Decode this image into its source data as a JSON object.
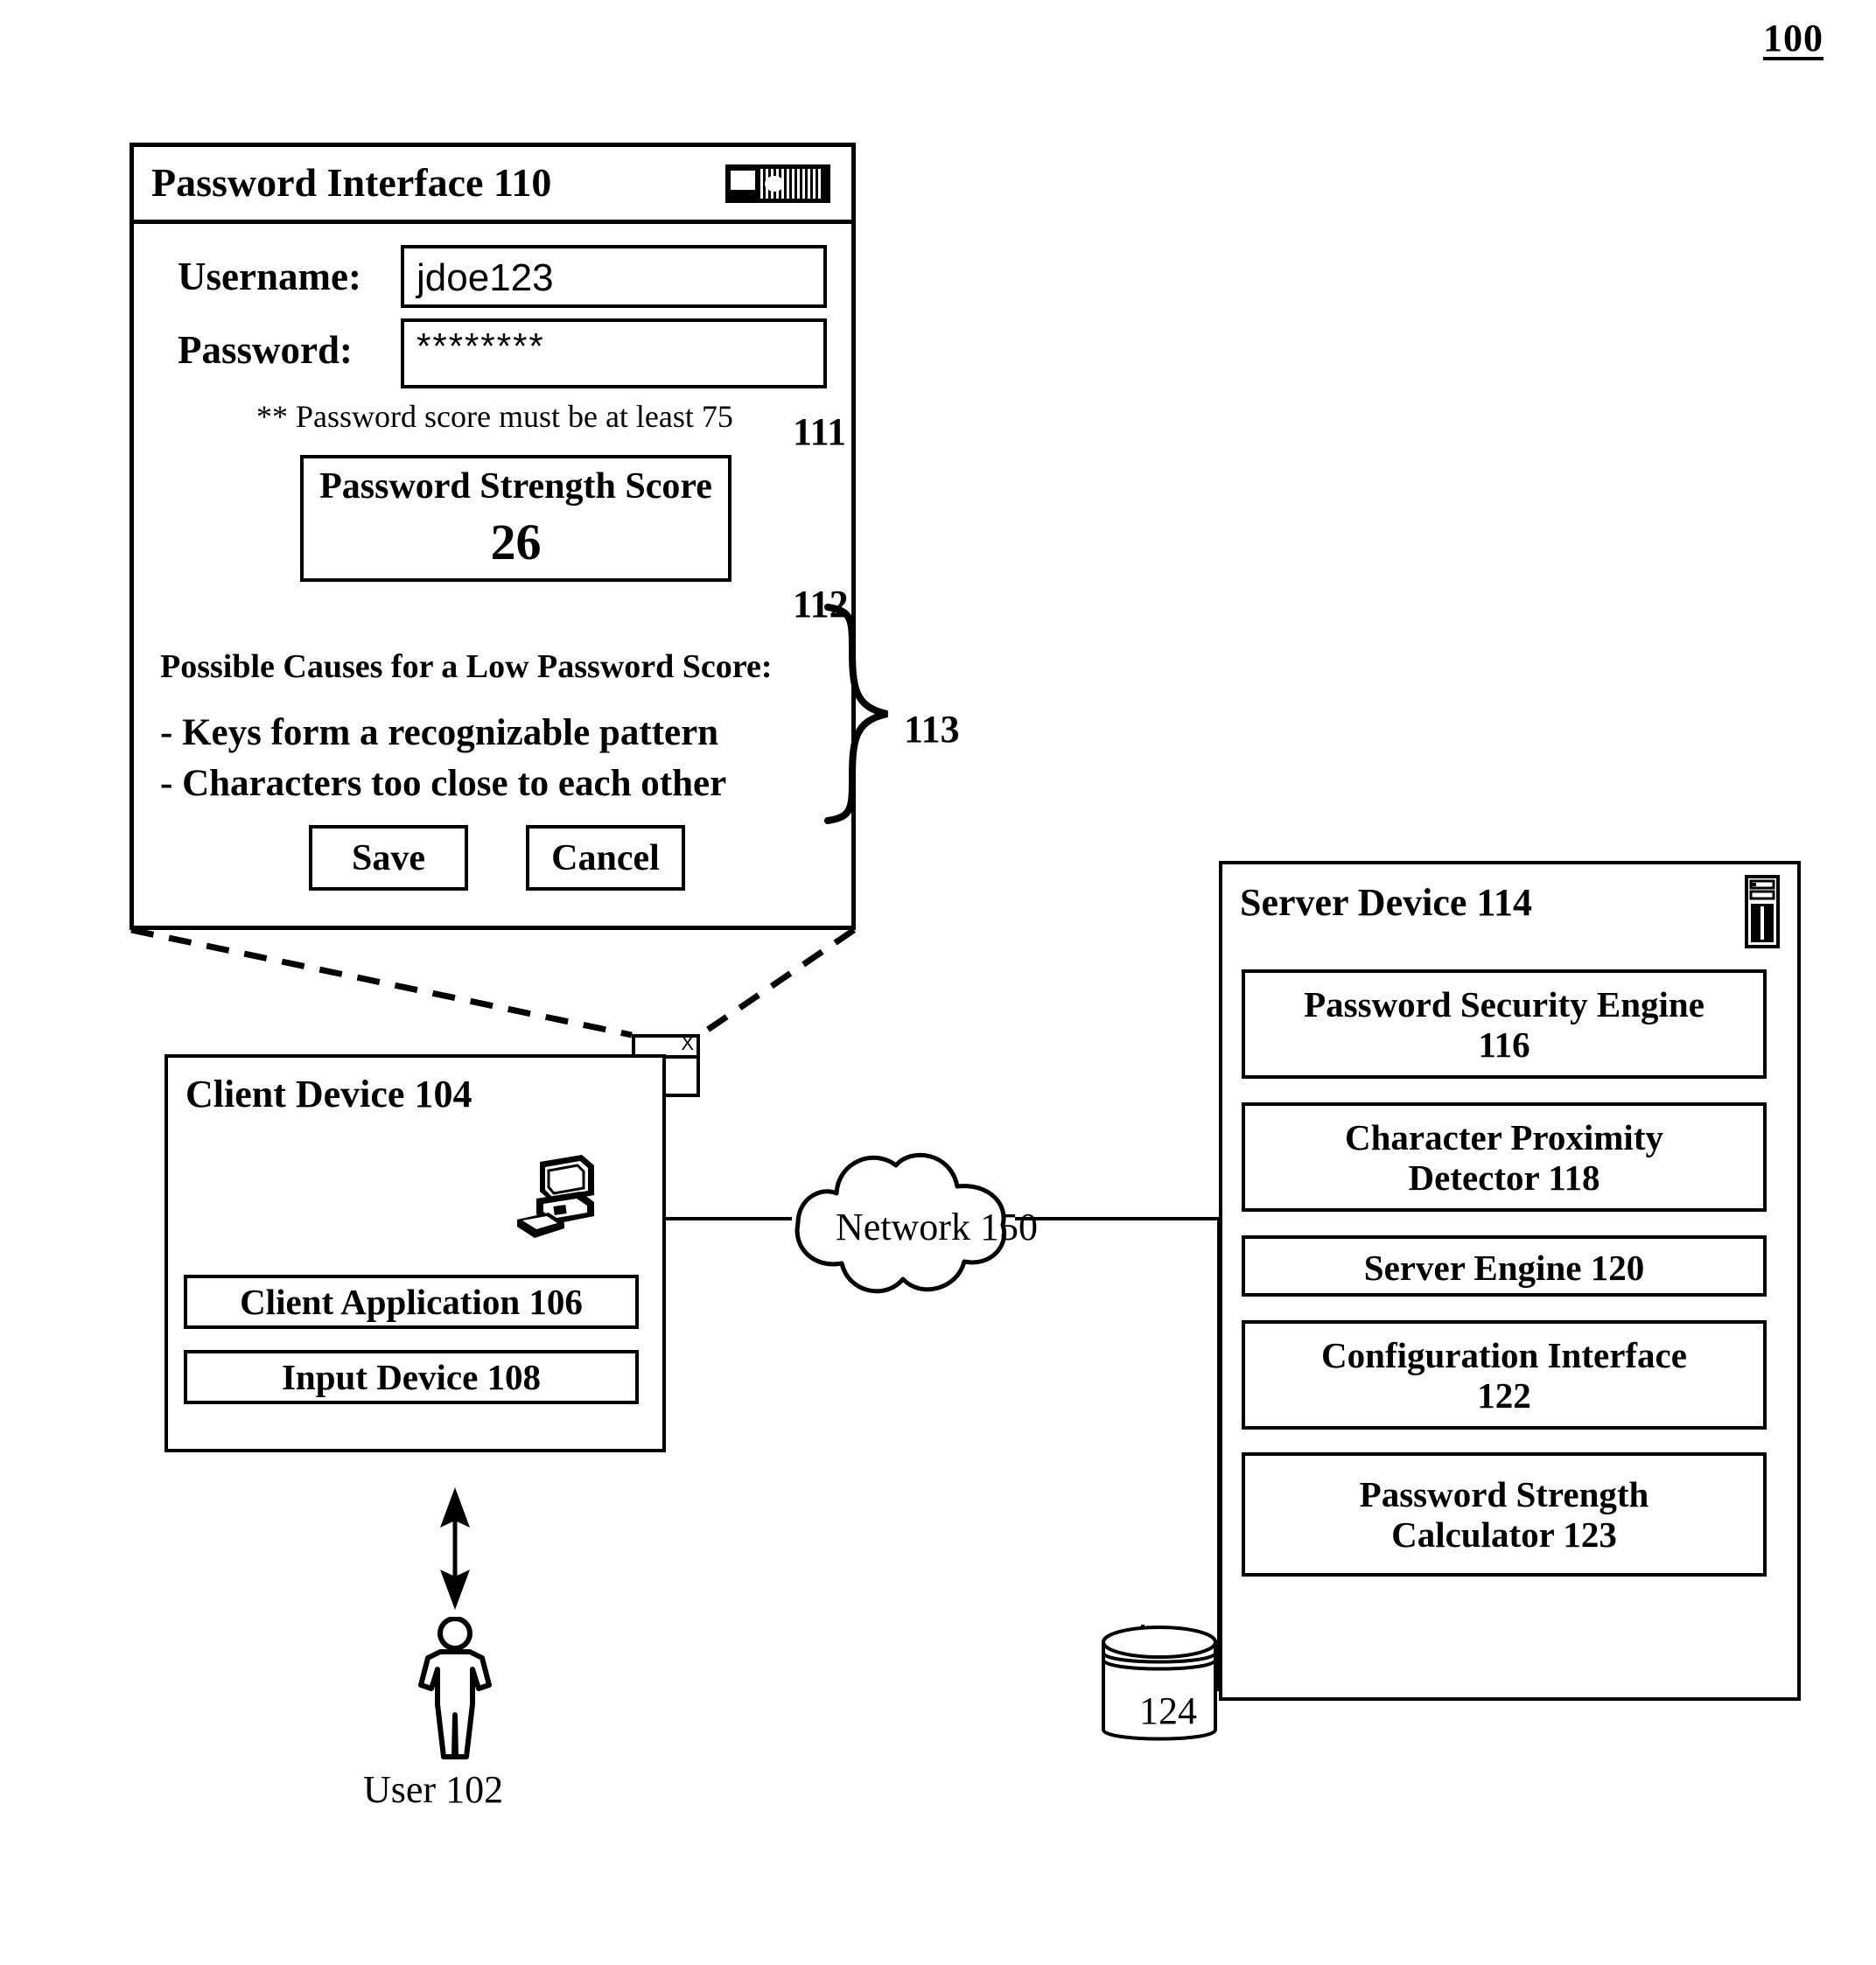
{
  "figure": {
    "number": "100"
  },
  "password_interface": {
    "title": "Password Interface 110",
    "window_controls_icon": "minimize-maximize-close-icon",
    "username_label": "Username:",
    "username_value": "jdoe123",
    "password_label": "Password:",
    "password_value": "********",
    "score_note": "** Password score must be at least 75",
    "ref_111": "111",
    "score_box": {
      "title": "Password Strength Score",
      "value": "26"
    },
    "ref_112": "112",
    "causes_title": "Possible Causes for a Low Password Score:",
    "causes": [
      "- Keys form a recognizable pattern",
      "- Characters too close to each other"
    ],
    "ref_113": "113",
    "save_label": "Save",
    "cancel_label": "Cancel"
  },
  "mini_window": {
    "close_label": "X"
  },
  "client_device": {
    "title": "Client Device 104",
    "computer_icon": "desktop-computer-icon",
    "modules": [
      "Client Application 106",
      "Input Device 108"
    ]
  },
  "user": {
    "label": "User 102",
    "figure_icon": "person-icon",
    "arrow_icon": "double-headed-arrow-icon"
  },
  "network": {
    "label": "Network 150",
    "icon": "cloud-icon"
  },
  "server_device": {
    "title": "Server Device 114",
    "tower_icon": "server-tower-icon",
    "modules": [
      {
        "line1": "Password Security Engine",
        "line2": "116"
      },
      {
        "line1": "Character Proximity",
        "line2": "Detector 118"
      },
      {
        "line1": "Server Engine 120",
        "line2": ""
      },
      {
        "line1": "Configuration Interface",
        "line2": "122"
      },
      {
        "line1": "Password Strength",
        "line2": "Calculator 123"
      }
    ]
  },
  "database": {
    "label": "124",
    "icon": "database-cylinder-icon"
  }
}
